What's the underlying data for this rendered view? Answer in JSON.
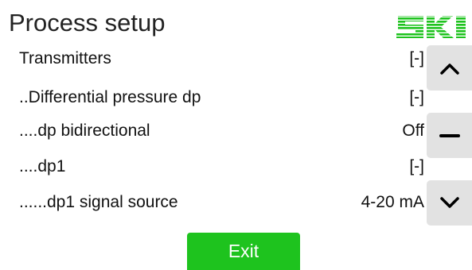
{
  "header": {
    "title": "Process setup",
    "logo_text": "SKI",
    "logo_color": "#1ec31e"
  },
  "rows": [
    {
      "label": "Transmitters",
      "value": "[-]"
    },
    {
      "label": "..Differential pressure dp",
      "value": "[-]"
    },
    {
      "label": "....dp bidirectional",
      "value": "Off"
    },
    {
      "label": "....dp1",
      "value": "[-]"
    },
    {
      "label": "......dp1 signal source",
      "value": "4-20 mA"
    }
  ],
  "side_buttons": {
    "up_icon": "chevron-up-icon",
    "toggle_icon": "minus-icon",
    "down_icon": "chevron-down-icon",
    "background_color": "#e2e2e2"
  },
  "footer": {
    "exit_label": "Exit",
    "exit_color": "#1ec31e"
  }
}
